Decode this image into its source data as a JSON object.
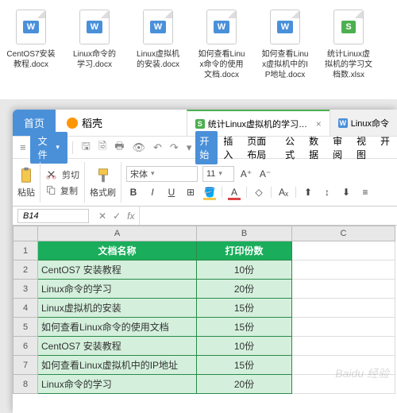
{
  "desktop_files": [
    {
      "badge": "W",
      "badge_class": "badge-w",
      "name": "CentOS7安装教程.docx"
    },
    {
      "badge": "W",
      "badge_class": "badge-w",
      "name": "Linux命令的学习.docx"
    },
    {
      "badge": "W",
      "badge_class": "badge-w",
      "name": "Linux虚拟机的安装.docx"
    },
    {
      "badge": "W",
      "badge_class": "badge-w",
      "name": "如何查看Linux命令的使用文档.docx"
    },
    {
      "badge": "W",
      "badge_class": "badge-w",
      "name": "如何查看Linux虚拟机中的IP地址.docx"
    },
    {
      "badge": "S",
      "badge_class": "badge-s",
      "name": "统计Linux虚拟机的学习文档数.xlsx"
    }
  ],
  "main_tabs": {
    "home": "首页",
    "daoke": "稻壳"
  },
  "doc_tabs": [
    {
      "label": "统计Linux虚拟机的学习文档数.xlsx",
      "type": "green",
      "active": true
    },
    {
      "label": "Linux命令",
      "type": "blue",
      "active": false
    }
  ],
  "file_menu": "文件",
  "ribbon": {
    "start": "开始",
    "insert": "插入",
    "layout": "页面布局",
    "formula": "公式",
    "data": "数据",
    "review": "审阅",
    "view": "视图",
    "open": "开"
  },
  "toolbar": {
    "paste": "粘贴",
    "cut": "剪切",
    "copy": "复制",
    "format_painter": "格式刷",
    "font_name": "宋体",
    "font_size": "11"
  },
  "name_box": "B14",
  "columns": [
    "A",
    "B",
    "C"
  ],
  "table_header": {
    "name": "文档名称",
    "copies": "打印份数"
  },
  "table_rows": [
    {
      "name": "CentOS7 安装教程",
      "copies": "10份"
    },
    {
      "name": "Linux命令的学习",
      "copies": "20份"
    },
    {
      "name": "Linux虚拟机的安装",
      "copies": "15份"
    },
    {
      "name": "如何查看Linux命令的使用文档",
      "copies": "15份"
    },
    {
      "name": "CentOS7 安装教程",
      "copies": "10份"
    },
    {
      "name": "如何查看Linux虚拟机中的IP地址",
      "copies": "15份"
    },
    {
      "name": "Linux命令的学习",
      "copies": "20份"
    }
  ],
  "watermark": "Baidu 经验"
}
